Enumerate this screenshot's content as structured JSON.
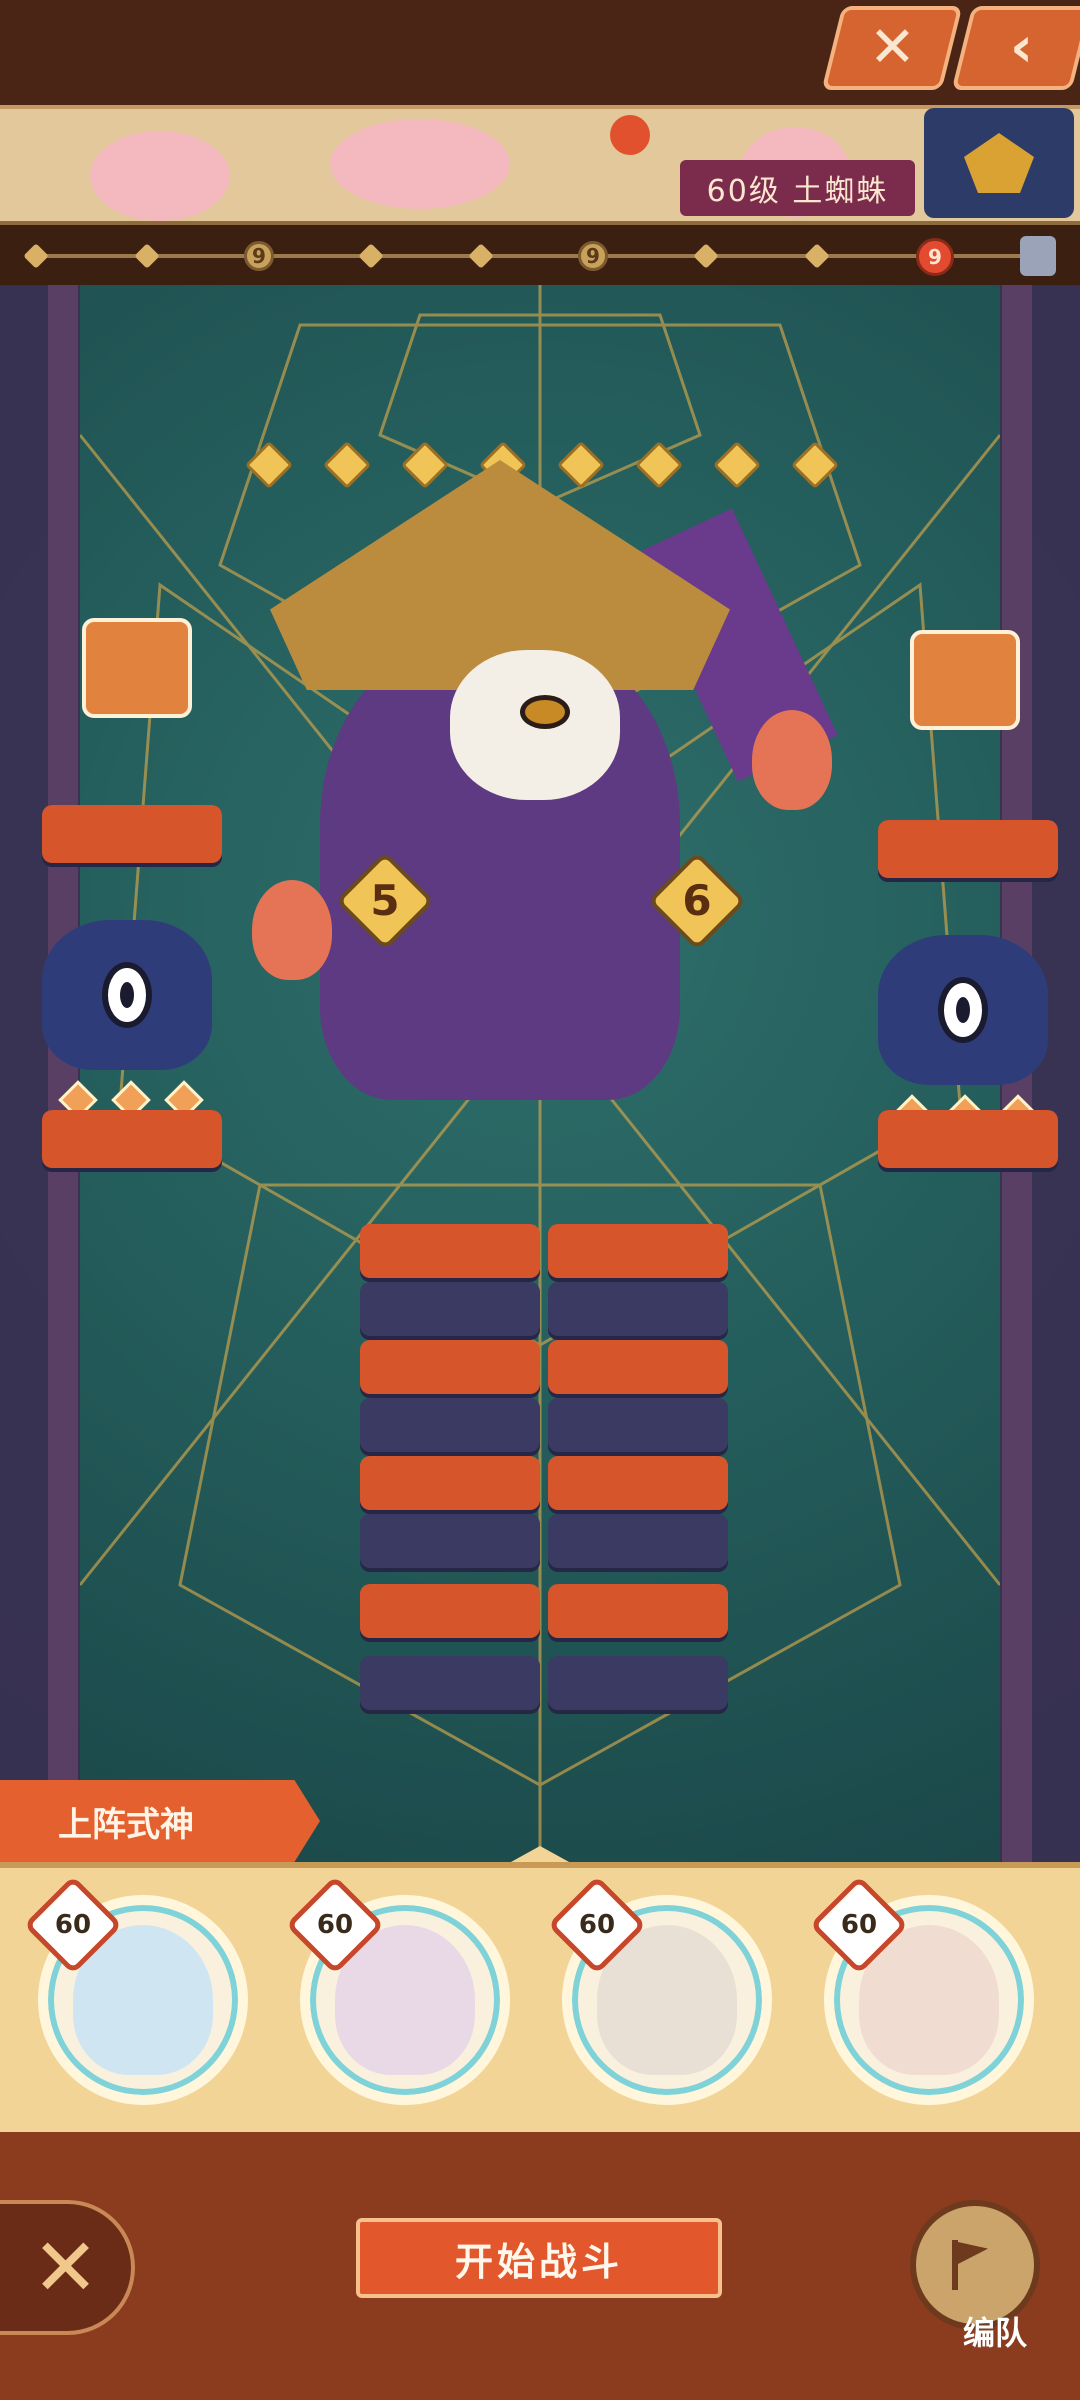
{
  "top_bar": {
    "close_icon": "✕",
    "back_icon": "‹"
  },
  "banner": {
    "boss_level_label": "60级 土蜘蛛"
  },
  "progress": {
    "waypoints": [
      "",
      "",
      "9",
      "",
      "",
      "9",
      "",
      "",
      "9"
    ]
  },
  "boss": {
    "stars": 8,
    "left_badge": "5",
    "right_badge": "6"
  },
  "team": {
    "title": "上阵式神",
    "members": [
      {
        "level": "60",
        "color": "#cfe6f2"
      },
      {
        "level": "60",
        "color": "#e9d9e6"
      },
      {
        "level": "60",
        "color": "#e8e0d4"
      },
      {
        "level": "60",
        "color": "#f1dcd2"
      }
    ]
  },
  "actions": {
    "close": "✕",
    "start": "开始战斗",
    "formation": "编队"
  },
  "colors": {
    "accent": "#e2572b",
    "panel": "#f2d596",
    "arena": "#245e5c"
  }
}
